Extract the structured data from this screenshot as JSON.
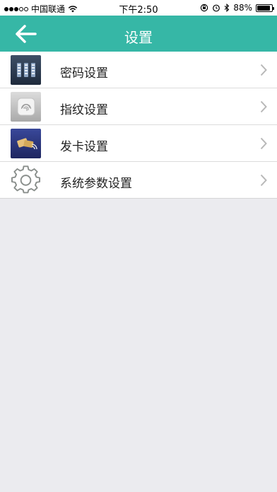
{
  "status_bar": {
    "carrier": "中国联通",
    "time": "下午2:50",
    "battery": "88%",
    "battery_level": 0.88
  },
  "nav": {
    "title": "设置",
    "back_icon": "arrow-left-icon"
  },
  "settings": [
    {
      "label": "密码设置",
      "icon": "keypad-icon"
    },
    {
      "label": "指纹设置",
      "icon": "fingerprint-icon"
    },
    {
      "label": "发卡设置",
      "icon": "card-icon"
    },
    {
      "label": "系统参数设置",
      "icon": "gear-icon"
    }
  ],
  "colors": {
    "header": "#36b7a6",
    "background": "#ebebef",
    "chevron": "#b8b8b8"
  }
}
